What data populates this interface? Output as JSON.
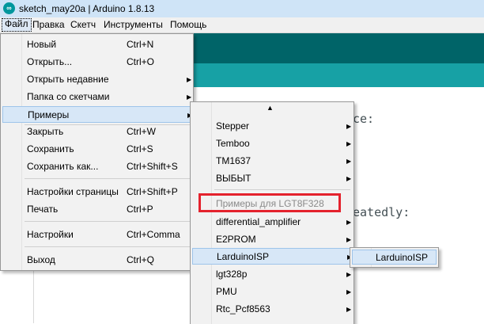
{
  "window": {
    "title": "sketch_may20a | Arduino 1.8.13",
    "icon": "arduino-icon"
  },
  "menubar": {
    "items": [
      "Файл",
      "Правка",
      "Скетч",
      "Инструменты",
      "Помощь"
    ]
  },
  "editor": {
    "line1": "ce:",
    "line2": "eatedly:"
  },
  "file_menu": {
    "items": [
      {
        "label": "Новый",
        "shortcut": "Ctrl+N"
      },
      {
        "label": "Открыть...",
        "shortcut": "Ctrl+O"
      },
      {
        "label": "Открыть недавние",
        "shortcut": ""
      },
      {
        "label": "Папка со скетчами",
        "shortcut": ""
      },
      {
        "label": "Примеры",
        "shortcut": ""
      },
      {
        "label": "Закрыть",
        "shortcut": "Ctrl+W"
      },
      {
        "label": "Сохранить",
        "shortcut": "Ctrl+S"
      },
      {
        "label": "Сохранить как...",
        "shortcut": "Ctrl+Shift+S"
      },
      {
        "label": "Настройки страницы",
        "shortcut": "Ctrl+Shift+P"
      },
      {
        "label": "Печать",
        "shortcut": "Ctrl+P"
      },
      {
        "label": "Настройки",
        "shortcut": "Ctrl+Comma"
      },
      {
        "label": "Выход",
        "shortcut": "Ctrl+Q"
      }
    ]
  },
  "examples_menu": {
    "items": [
      {
        "label": "Stepper"
      },
      {
        "label": "Temboo"
      },
      {
        "label": "TM1637"
      },
      {
        "label": "ВЫБЫТ"
      },
      {
        "label": "Примеры для LGT8F328"
      },
      {
        "label": "differential_amplifier"
      },
      {
        "label": "E2PROM"
      },
      {
        "label": "LarduinoISP"
      },
      {
        "label": "lgt328p"
      },
      {
        "label": "PMU"
      },
      {
        "label": "Rtc_Pcf8563"
      }
    ]
  },
  "larduino_submenu": {
    "items": [
      {
        "label": "LarduinoISP"
      }
    ]
  },
  "colors": {
    "teal_dark": "#006468",
    "teal": "#17a1a5",
    "highlight": "#d7e7f7",
    "annotation": "#e4222d"
  }
}
